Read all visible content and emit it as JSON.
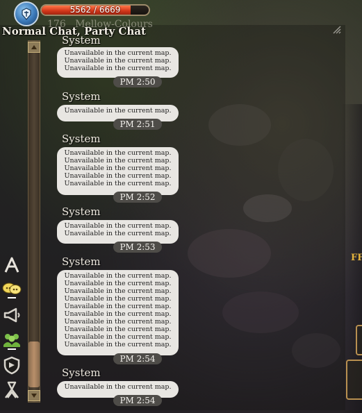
{
  "player": {
    "hp_text": "5562 / 6669",
    "hp_fraction": 0.834,
    "level": "176",
    "name": "Mellow-Colours"
  },
  "chat": {
    "title": "Normal Chat, Party Chat",
    "messages": [
      {
        "sender": "System",
        "lines": [
          "Unavailable in the current map.",
          "Unavailable in the current map.",
          "Unavailable in the current map."
        ],
        "time": "PM 2:50"
      },
      {
        "sender": "System",
        "lines": [
          "Unavailable in the current map."
        ],
        "time": "PM 2:51"
      },
      {
        "sender": "System",
        "lines": [
          "Unavailable in the current map.",
          "Unavailable in the current map.",
          "Unavailable in the current map.",
          "Unavailable in the current map.",
          "Unavailable in the current map."
        ],
        "time": "PM 2:52"
      },
      {
        "sender": "System",
        "lines": [
          "Unavailable in the current map.",
          "Unavailable in the current map."
        ],
        "time": "PM 2:53"
      },
      {
        "sender": "System",
        "lines": [
          "Unavailable in the current map.",
          "Unavailable in the current map.",
          "Unavailable in the current map.",
          "Unavailable in the current map.",
          "Unavailable in the current map.",
          "Unavailable in the current map.",
          "Unavailable in the current map.",
          "Unavailable in the current map.",
          "Unavailable in the current map.",
          "Unavailable in the current map."
        ],
        "time": "PM 2:54"
      },
      {
        "sender": "System",
        "lines": [
          "Unavailable in the current map."
        ],
        "time": "PM 2:54"
      }
    ]
  },
  "sidebar_icons": [
    "font-size-icon",
    "chat-bubbles-icon",
    "megaphone-icon",
    "party-icon",
    "guild-shield-icon",
    "ribbon-icon"
  ],
  "world": {
    "partial_label": "FF"
  },
  "colors": {
    "hp_fill": "#d6391c",
    "timestamp_bg": "#4e4c48",
    "bubble_bg": "#e8e6e2",
    "accent_gold": "#e4b33c"
  }
}
